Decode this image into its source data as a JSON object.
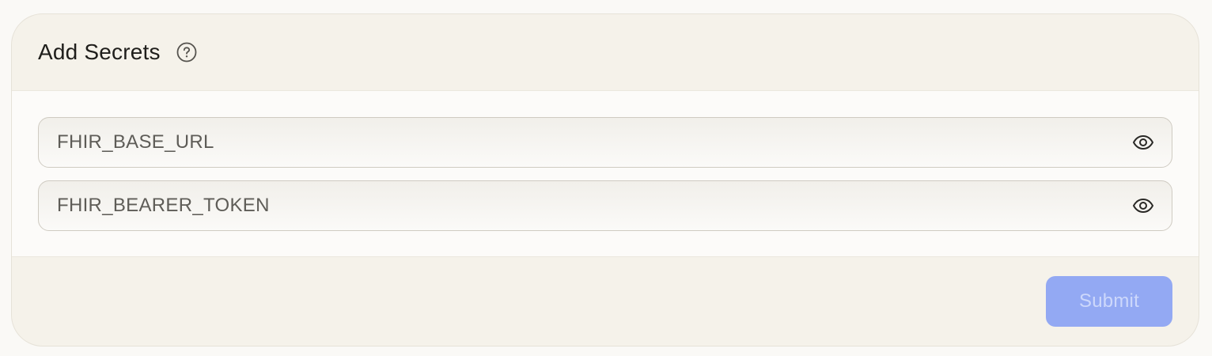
{
  "header": {
    "title": "Add Secrets",
    "help_icon": "question-circle-icon"
  },
  "fields": [
    {
      "placeholder": "FHIR_BASE_URL",
      "value": "",
      "toggle_icon": "eye-icon"
    },
    {
      "placeholder": "FHIR_BEARER_TOKEN",
      "value": "",
      "toggle_icon": "eye-icon"
    }
  ],
  "footer": {
    "submit_label": "Submit",
    "submit_disabled": true
  },
  "colors": {
    "card_background": "#f5f2ea",
    "body_background": "#fcfbf9",
    "submit_disabled": "#93a9f3"
  }
}
